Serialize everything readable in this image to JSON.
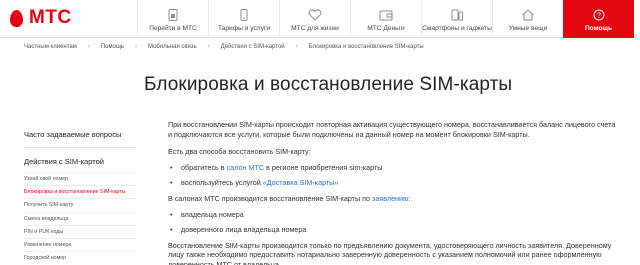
{
  "brand": {
    "name": "МТС",
    "color": "#e30611"
  },
  "nav": [
    {
      "label": "Перейти в МТС",
      "icon": "sim-card-icon"
    },
    {
      "label": "Тарифы и услуги",
      "icon": "phone-icon"
    },
    {
      "label": "МТС для жизни",
      "icon": "heart-icon"
    },
    {
      "label": "МТС Деньги",
      "icon": "wallet-icon"
    },
    {
      "label": "Смартфоны и гаджеты",
      "icon": "smartphone-icon"
    },
    {
      "label": "Умные вещи",
      "icon": "smart-home-icon"
    },
    {
      "label": "Помощь",
      "icon": "help-icon"
    }
  ],
  "breadcrumb": [
    "Частным клиентам",
    "Помощь",
    "Мобильная связь",
    "Действия с SIM-картой",
    "Блокировка и восстановление SIM-карты"
  ],
  "title": "Блокировка и восстановление SIM-карты",
  "sidebar": {
    "faq": "Часто задаваемые вопросы",
    "section": "Действия с SIM-картой",
    "items": [
      {
        "label": "Узнай свой номер",
        "active": false
      },
      {
        "label": "Блокировка и восстановление SIM-карты",
        "active": true
      },
      {
        "label": "Получить SIM-карту",
        "active": false
      },
      {
        "label": "Смена владельца",
        "active": false
      },
      {
        "label": "PIN и PUK коды",
        "active": false
      },
      {
        "label": "Изменение номера",
        "active": false
      },
      {
        "label": "Городской номер",
        "active": false
      }
    ]
  },
  "content": {
    "p1": "При восстановлении SIM-карты происходит повторная активация существующего номера, восстанавливается баланс лицевого счета и подключаются все услуги, которые были подключены на данный номер на момент блокировки SIM-карты.",
    "p2": "Есть два способа восстановить SIM-карту:",
    "b1_pre": "обратитесь в ",
    "b1_link": "салон МТС",
    "b1_post": " в регионе приобретения sim-карты",
    "b2_pre": "воспользуйтесь услугой ",
    "b2_link": "«Доставка SIM-карты»",
    "p3_pre": "В салонах МТС производится восстановление SIM-карты по ",
    "p3_link": "заявлению",
    "p3_post": ":",
    "b3": "владельца номера",
    "b4": "доверенного лица владельца номера",
    "p4": "Восстановление SIM-карты производится только по предъявлению документа, удостоверяющего личность заявителя. Доверенному лицу также необходимо предоставить нотариально заверенную доверенность с указанием полномочий или ранее оформленную доверенность МТС от владельца."
  }
}
